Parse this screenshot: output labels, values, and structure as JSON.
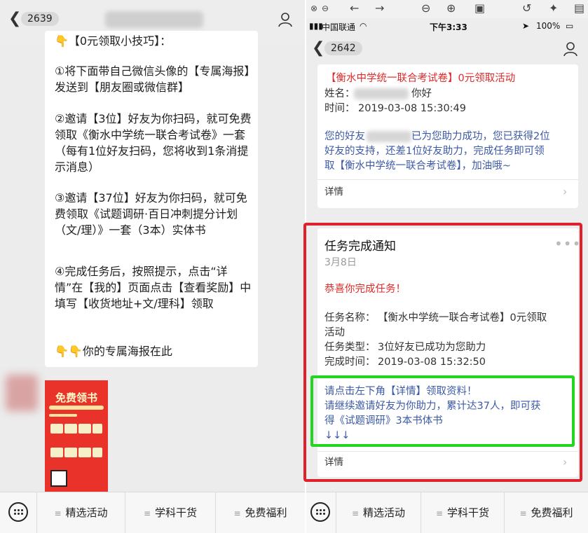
{
  "left": {
    "header": {
      "count_badge": "2639"
    },
    "message": {
      "tip_title": "👇【0元领取小技巧】：",
      "step1": "①将下面带自己微信头像的【专属海报】发送到【朋友圈或微信群】",
      "step2": "②邀请【3位】好友为你扫码，就可免费领取《衡水中学统一联合考试卷》一套（每有1位好友扫码，您将收到1条消提示消息）",
      "step3": "③邀请【37位】好友为你扫码，就可免费领取《试题调研·百日冲刺提分计划（文/理）》一套（3本）实体书",
      "step4": "④完成任务后，按照提示，点击“详情”在【我的】页面点击【查看奖励】中填写【收货地址+文/理科】领取",
      "poster_hint": "👇👇你的专属海报在此"
    },
    "poster": {
      "title": "免费领书"
    },
    "menu": [
      "精选活动",
      "学科干货",
      "免费福利"
    ]
  },
  "right": {
    "status": {
      "carrier": "中国联通",
      "time": "下午3:33",
      "battery": "100%"
    },
    "header": {
      "count_badge": "2642"
    },
    "card1": {
      "headline": "【衡水中学统一联合考试卷】0元领取活动",
      "name_label": "姓名：",
      "name_suffix": "你好",
      "time_label": "时间：",
      "time_value": "2019-03-08 15:30:49",
      "body_prefix": "您的好友",
      "body_line1_suffix": "已为您助力成功，您已获得2位",
      "body_line2": "好友的支持，还差1位好友助力，完成任务即可领",
      "body_line3": "取【衡水中学统一联合考试卷】，加油哦~",
      "details": "详情"
    },
    "card2": {
      "title": "任务完成通知",
      "date": "3月8日",
      "congrats": "恭喜你完成任务！",
      "task_name_label": "任务名称：",
      "task_name_value": "【衡水中学统一联合考试卷】0元领取",
      "task_name_value2": "活动",
      "task_type_label": "任务类型：",
      "task_type_value": "3位好友已成功为您助力",
      "done_time_label": "完成时间：",
      "done_time_value": "2019-03-08 15:32:50",
      "note_line1": "请点击左下角【详情】领取资料！",
      "note_line2": "请继续邀请好友为你助力，累计达37人，即可获",
      "note_line3": "得《试题调研》3本书体书",
      "note_line4": "↓↓↓",
      "details": "详情"
    },
    "menu": [
      "精选活动",
      "学科干货",
      "免费福利"
    ]
  },
  "colors": {
    "highlight_red": "#e0202a",
    "highlight_green": "#22d622",
    "link_blue": "#3d5aa8",
    "alert_red": "#e02a2a"
  }
}
